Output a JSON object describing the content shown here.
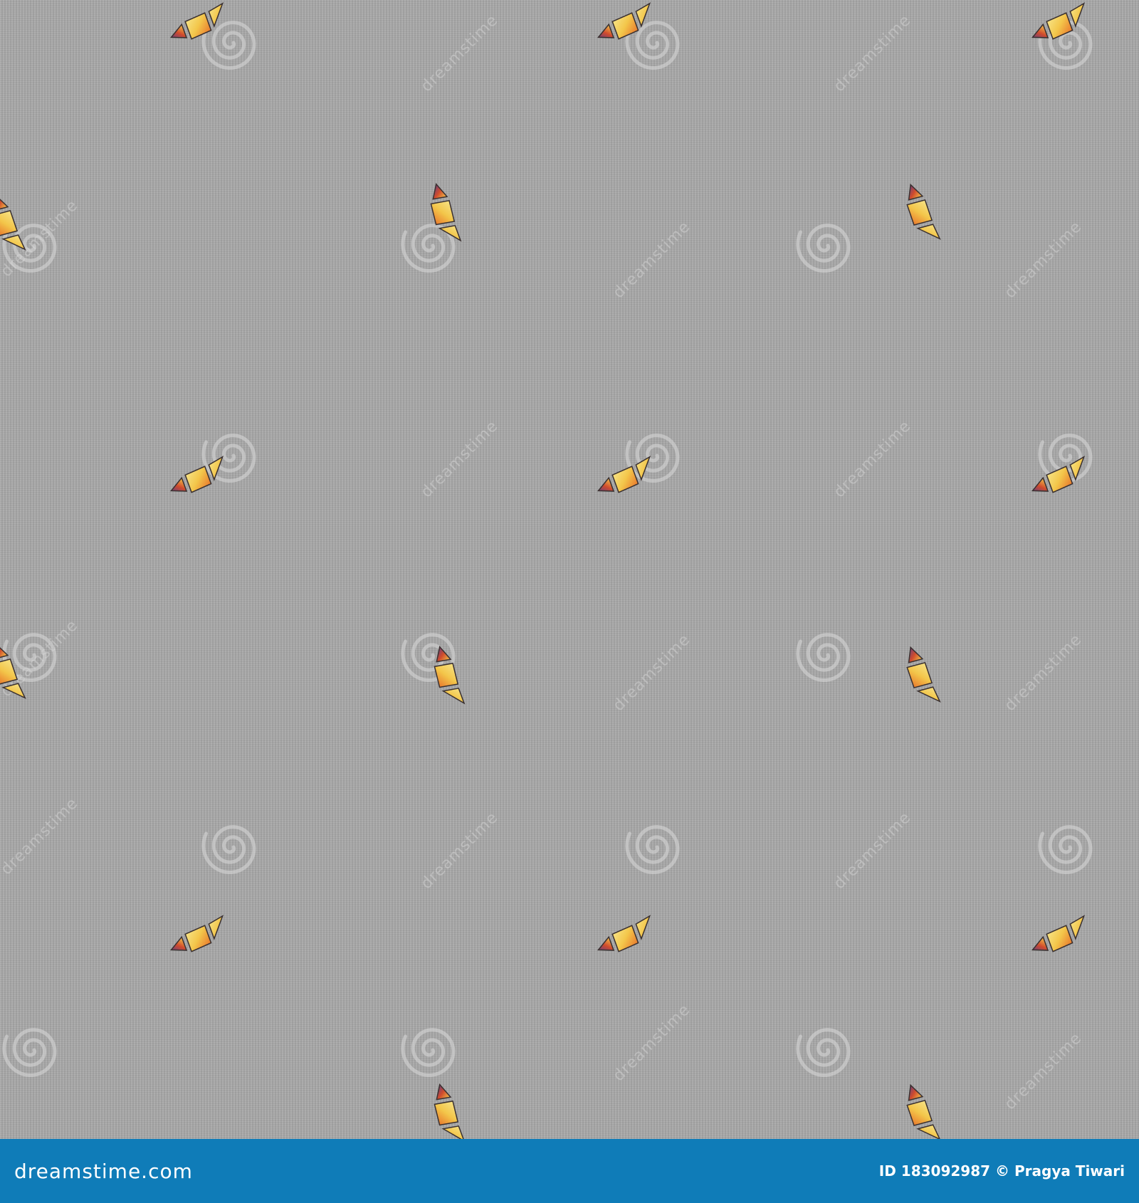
{
  "image": {
    "description_type": "seamless-pattern",
    "background_color": "#a8a8a8",
    "motif_colors": [
      "#f3c64a",
      "#e8732a",
      "#3b3aa0",
      "#f7e58a",
      "#d14b2c"
    ],
    "watermark_color": "#d9d9d9"
  },
  "watermark": {
    "text": "dreamstime"
  },
  "footer": {
    "background": "#0f7cb8",
    "logo": "dreamstime.com",
    "id_label": "ID 183092987",
    "author": "© Pragya Tiwari"
  }
}
